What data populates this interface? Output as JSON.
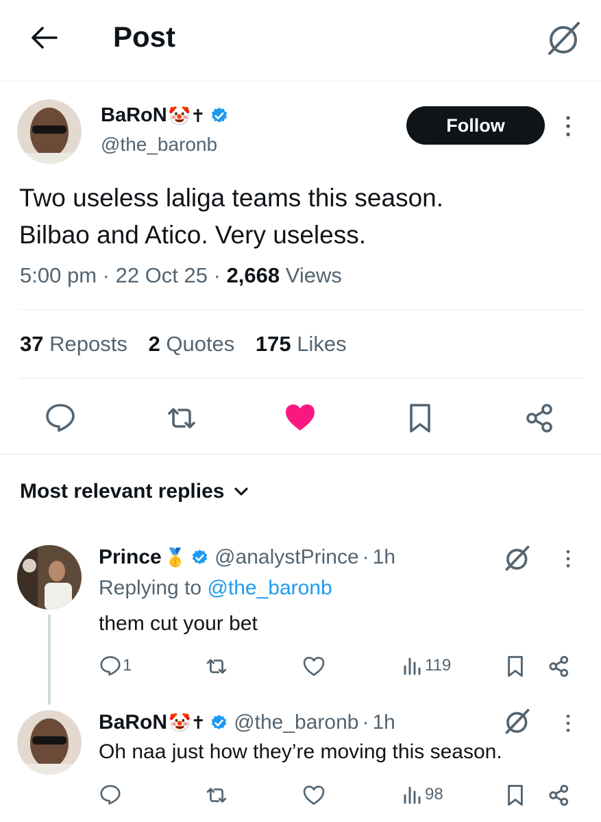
{
  "header": {
    "back_icon": "arrow-left-icon",
    "title": "Post",
    "grok_icon": "grok-icon"
  },
  "post": {
    "author": {
      "display_name": "BaRoN",
      "emojis": "🤡✝",
      "handle": "@the_baronb",
      "verified": true
    },
    "follow_label": "Follow",
    "text_line1": "Two useless laliga teams this season.",
    "text_line2": "Bilbao and Atico. Very useless.",
    "time": "5:00 pm",
    "date": "22 Oct 25",
    "views_count": "2,668",
    "views_label": "Views",
    "stats": {
      "reposts_count": "37",
      "reposts_label": "Reposts",
      "quotes_count": "2",
      "quotes_label": "Quotes",
      "likes_count": "175",
      "likes_label": "Likes"
    },
    "like_color": "#f91880"
  },
  "replies_sort": {
    "label": "Most relevant replies"
  },
  "replies": [
    {
      "display_name": "Prince",
      "emoji": "🥇",
      "handle": "@analystPrince",
      "time": "1h",
      "replying_to_label": "Replying to",
      "replying_to_handle": "@the_baronb",
      "text": "them cut your bet",
      "reply_count": "1",
      "views": "119"
    },
    {
      "display_name": "BaRoN",
      "emoji": "🤡✝",
      "handle": "@the_baronb",
      "time": "1h",
      "text": "Oh naa just how they’re moving this season.",
      "views": "98"
    }
  ],
  "colors": {
    "accent_blue": "#1d9bf0",
    "text_primary": "#0f1419",
    "text_secondary": "#536471"
  }
}
